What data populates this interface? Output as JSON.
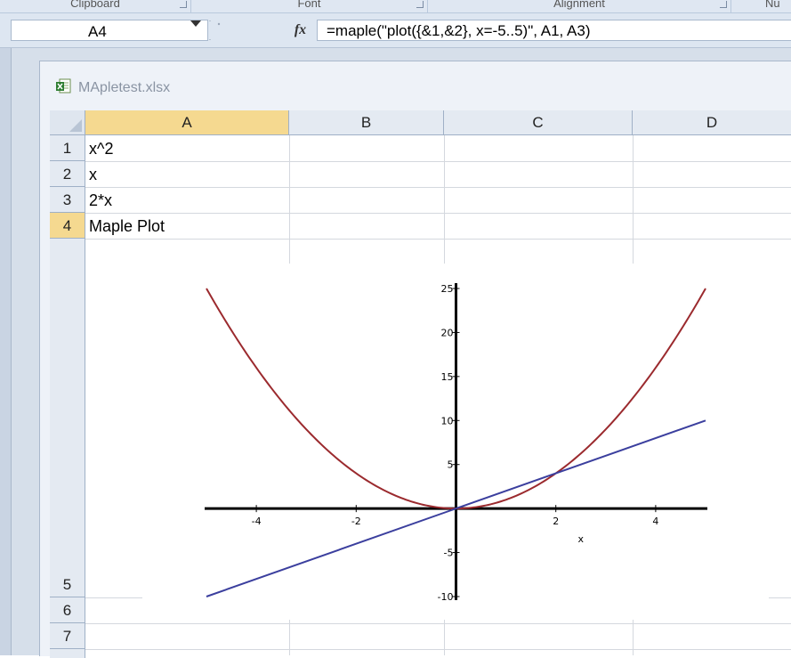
{
  "ribbon": {
    "groups": [
      "Clipboard",
      "Font",
      "Alignment",
      "Nu"
    ]
  },
  "formula_bar": {
    "name_box": "A4",
    "fx_label": "fx",
    "formula": "=maple(\"plot({&1,&2}, x=-5..5)\", A1, A3)"
  },
  "workbook": {
    "title": "MApletest.xlsx"
  },
  "grid": {
    "columns": [
      "A",
      "B",
      "C",
      "D"
    ],
    "rows": [
      "1",
      "2",
      "3",
      "4",
      "5",
      "6",
      "7"
    ],
    "cells": {
      "A1": "x^2",
      "A2": "x",
      "A3": "2*x",
      "A4": "Maple Plot"
    }
  },
  "colors": {
    "curve_quadratic": "#9b2a2e",
    "curve_linear": "#3b3f9e",
    "selected_header": "#f5d990"
  },
  "chart_data": {
    "type": "line",
    "xlabel": "x",
    "xlim": [
      -5,
      5
    ],
    "ylim": [
      -10,
      25
    ],
    "x_ticks": [
      -4,
      -2,
      0,
      2,
      4
    ],
    "y_ticks": [
      -10,
      -5,
      5,
      10,
      15,
      20,
      25
    ],
    "x_tick_labels": [
      "-4",
      "-2",
      "2",
      "4"
    ],
    "y_tick_labels": [
      "-10",
      "-5",
      "5",
      "10",
      "15",
      "20",
      "25"
    ],
    "series": [
      {
        "expression": "x^2",
        "x": [
          -5,
          -4,
          -3,
          -2,
          -1,
          0,
          1,
          2,
          3,
          4,
          5
        ],
        "y": [
          25,
          16,
          9,
          4,
          1,
          0,
          1,
          4,
          9,
          16,
          25
        ]
      },
      {
        "expression": "2*x",
        "x": [
          -5,
          5
        ],
        "y": [
          -10,
          10
        ]
      }
    ]
  }
}
